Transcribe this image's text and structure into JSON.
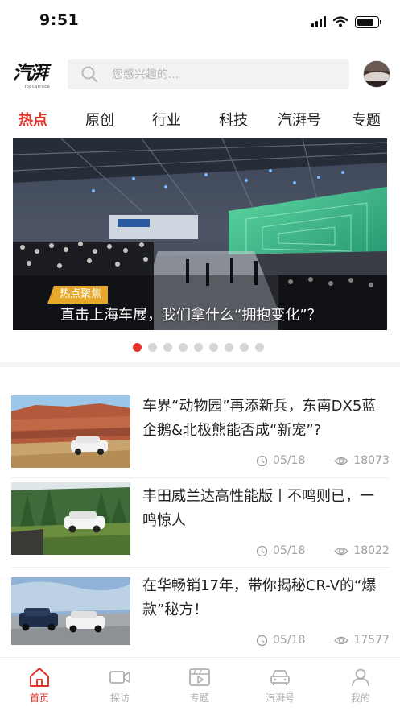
{
  "status_bar": {
    "time": "9:51"
  },
  "header": {
    "logo_text": "汽湃",
    "logo_subtext": "Topcarrace",
    "search_placeholder": "您感兴趣的..."
  },
  "tabs": [
    {
      "label": "热点",
      "active": true
    },
    {
      "label": "原创",
      "active": false
    },
    {
      "label": "行业",
      "active": false
    },
    {
      "label": "科技",
      "active": false
    },
    {
      "label": "汽湃号",
      "active": false
    },
    {
      "label": "专题",
      "active": false
    }
  ],
  "banner": {
    "tag": "热点聚焦",
    "title": "直击上海车展，我们拿什么“拥抱变化”？",
    "slide_count": 9,
    "active_slide": 1
  },
  "articles": [
    {
      "title": "车界“动物园”再添新兵，东南DX5蓝企鹅&北极熊能否成“新宠”?",
      "date": "05/18",
      "views": "18073"
    },
    {
      "title": "丰田威兰达高性能版丨不鸣则已，一鸣惊人",
      "date": "05/18",
      "views": "18022"
    },
    {
      "title": "在华畅销17年，带你揭秘CR-V的“爆款”秘方！",
      "date": "05/18",
      "views": "17577"
    }
  ],
  "bottom_nav": [
    {
      "label": "首页",
      "icon": "home-icon",
      "active": true
    },
    {
      "label": "探访",
      "icon": "video-camera-icon",
      "active": false
    },
    {
      "label": "专题",
      "icon": "video-clip-icon",
      "active": false
    },
    {
      "label": "汽湃号",
      "icon": "car-icon",
      "active": false
    },
    {
      "label": "我的",
      "icon": "user-icon",
      "active": false
    }
  ],
  "colors": {
    "accent": "#e5332a",
    "tag": "#e8a92b",
    "muted": "#a0a0a0"
  }
}
